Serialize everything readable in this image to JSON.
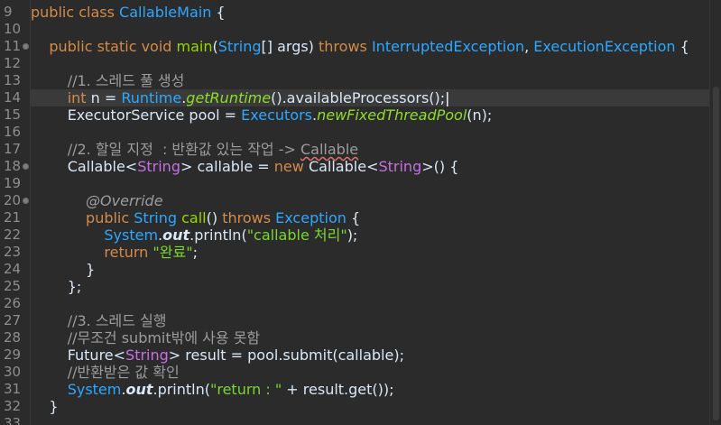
{
  "editor": {
    "lines": [
      {
        "number": "9",
        "fold": false,
        "tokens": [
          {
            "t": "public class ",
            "c": "kw"
          },
          {
            "t": "CallableMain",
            "c": "cls"
          },
          {
            "t": " {",
            "c": "plain"
          }
        ]
      },
      {
        "number": "10",
        "fold": false,
        "tokens": []
      },
      {
        "number": "11",
        "fold": true,
        "tokens": [
          {
            "t": "    public static void ",
            "c": "kw"
          },
          {
            "t": "main",
            "c": "method"
          },
          {
            "t": "(",
            "c": "plain"
          },
          {
            "t": "String",
            "c": "cls"
          },
          {
            "t": "[] args) ",
            "c": "plain"
          },
          {
            "t": "throws ",
            "c": "kw"
          },
          {
            "t": "InterruptedException",
            "c": "cls"
          },
          {
            "t": ", ",
            "c": "plain"
          },
          {
            "t": "ExecutionException",
            "c": "cls"
          },
          {
            "t": " {",
            "c": "plain"
          }
        ]
      },
      {
        "number": "12",
        "fold": false,
        "tokens": []
      },
      {
        "number": "13",
        "fold": false,
        "tokens": [
          {
            "t": "        //1. 스레드 풀 생성",
            "c": "comment"
          }
        ]
      },
      {
        "number": "14",
        "fold": false,
        "current": true,
        "tokens": [
          {
            "t": "        ",
            "c": "plain"
          },
          {
            "t": "int ",
            "c": "kw"
          },
          {
            "t": "n = ",
            "c": "plain"
          },
          {
            "t": "Runtime",
            "c": "cls"
          },
          {
            "t": ".",
            "c": "plain"
          },
          {
            "t": "getRuntime",
            "c": "static-method"
          },
          {
            "t": "().availableProcessors();",
            "c": "plain"
          },
          {
            "t": "|",
            "c": "caret"
          }
        ]
      },
      {
        "number": "15",
        "fold": false,
        "tokens": [
          {
            "t": "        ExecutorService pool = ",
            "c": "plain"
          },
          {
            "t": "Executors",
            "c": "cls"
          },
          {
            "t": ".",
            "c": "plain"
          },
          {
            "t": "newFixedThreadPool",
            "c": "static-method"
          },
          {
            "t": "(n);",
            "c": "plain"
          }
        ]
      },
      {
        "number": "16",
        "fold": false,
        "tokens": []
      },
      {
        "number": "17",
        "fold": false,
        "tokens": [
          {
            "t": "        //2. 할일 지정  : 반환값 있는 작업 -> ",
            "c": "comment"
          },
          {
            "t": "Callable",
            "c": "comment underline-wavy"
          }
        ]
      },
      {
        "number": "18",
        "fold": true,
        "tokens": [
          {
            "t": "        Callable<",
            "c": "plain"
          },
          {
            "t": "String",
            "c": "generic"
          },
          {
            "t": "> callable = ",
            "c": "plain"
          },
          {
            "t": "new ",
            "c": "kw"
          },
          {
            "t": "Callable",
            "c": "plain"
          },
          {
            "t": "<",
            "c": "plain"
          },
          {
            "t": "String",
            "c": "generic"
          },
          {
            "t": ">() {",
            "c": "plain"
          }
        ]
      },
      {
        "number": "19",
        "fold": false,
        "tokens": []
      },
      {
        "number": "20",
        "fold": true,
        "tokens": [
          {
            "t": "            @Override",
            "c": "annotation"
          }
        ]
      },
      {
        "number": "21",
        "fold": false,
        "tokens": [
          {
            "t": "            public ",
            "c": "kw"
          },
          {
            "t": "String ",
            "c": "cls"
          },
          {
            "t": "call",
            "c": "method"
          },
          {
            "t": "() ",
            "c": "plain"
          },
          {
            "t": "throws ",
            "c": "kw"
          },
          {
            "t": "Exception",
            "c": "cls"
          },
          {
            "t": " {",
            "c": "plain"
          }
        ]
      },
      {
        "number": "22",
        "fold": false,
        "tokens": [
          {
            "t": "                System",
            "c": "cls"
          },
          {
            "t": ".",
            "c": "plain"
          },
          {
            "t": "out",
            "c": "bold-italic"
          },
          {
            "t": ".println(",
            "c": "plain"
          },
          {
            "t": "\"callable 처리\"",
            "c": "string"
          },
          {
            "t": ");",
            "c": "plain"
          }
        ]
      },
      {
        "number": "23",
        "fold": false,
        "tokens": [
          {
            "t": "                return ",
            "c": "kw"
          },
          {
            "t": "\"완료\"",
            "c": "string"
          },
          {
            "t": ";",
            "c": "plain"
          }
        ]
      },
      {
        "number": "24",
        "fold": false,
        "tokens": [
          {
            "t": "            }",
            "c": "plain"
          }
        ]
      },
      {
        "number": "25",
        "fold": false,
        "tokens": [
          {
            "t": "        };",
            "c": "plain"
          }
        ]
      },
      {
        "number": "26",
        "fold": false,
        "tokens": []
      },
      {
        "number": "27",
        "fold": false,
        "tokens": [
          {
            "t": "        //3. 스레드 실행",
            "c": "comment"
          }
        ]
      },
      {
        "number": "28",
        "fold": false,
        "tokens": [
          {
            "t": "        //무조건 submit밖에 사용 못함",
            "c": "comment"
          }
        ]
      },
      {
        "number": "29",
        "fold": false,
        "tokens": [
          {
            "t": "        Future<",
            "c": "plain"
          },
          {
            "t": "String",
            "c": "generic"
          },
          {
            "t": "> result = pool.submit(callable);",
            "c": "plain"
          }
        ]
      },
      {
        "number": "30",
        "fold": false,
        "tokens": [
          {
            "t": "        //반환받은 값 확인",
            "c": "comment"
          }
        ]
      },
      {
        "number": "31",
        "fold": false,
        "tokens": [
          {
            "t": "        System",
            "c": "cls"
          },
          {
            "t": ".",
            "c": "plain"
          },
          {
            "t": "out",
            "c": "bold-italic"
          },
          {
            "t": ".println(",
            "c": "plain"
          },
          {
            "t": "\"return : \"",
            "c": "string"
          },
          {
            "t": " + result.get());",
            "c": "plain"
          }
        ]
      },
      {
        "number": "32",
        "fold": false,
        "tokens": [
          {
            "t": "    }",
            "c": "plain"
          }
        ]
      },
      {
        "number": "33",
        "fold": false,
        "tokens": []
      }
    ]
  },
  "colors": {
    "background": "#2b2b2b",
    "current_line": "#3a3a3a",
    "keyword": "#d38b49",
    "class": "#2ea7ff",
    "method": "#97d700",
    "comment": "#9c9c9c",
    "string": "#79d72d",
    "generic": "#c86fe2"
  }
}
